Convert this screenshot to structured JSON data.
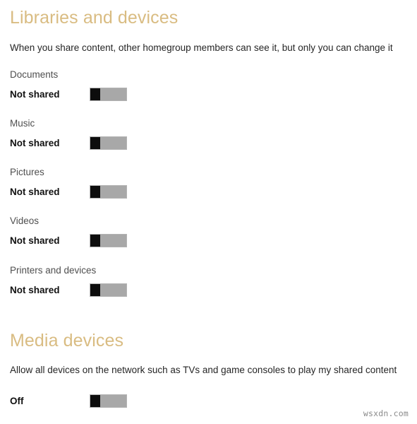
{
  "sections": [
    {
      "id": "libraries",
      "title": "Libraries and devices",
      "description": "When you share content, other homegroup members can see it, but only you can change it",
      "title_color": "#d9bc82",
      "rows": [
        {
          "label": "Documents",
          "state": "Not shared",
          "toggle": "off"
        },
        {
          "label": "Music",
          "state": "Not shared",
          "toggle": "off"
        },
        {
          "label": "Pictures",
          "state": "Not shared",
          "toggle": "off"
        },
        {
          "label": "Videos",
          "state": "Not shared",
          "toggle": "off"
        },
        {
          "label": "Printers and devices",
          "state": "Not shared",
          "toggle": "off"
        }
      ]
    },
    {
      "id": "media",
      "title": "Media devices",
      "description": "Allow all devices on the network such as TVs and game consoles to play my shared content",
      "title_color": "#d9bc82",
      "rows": [
        {
          "label": "",
          "state": "Off",
          "toggle": "off"
        }
      ]
    }
  ],
  "watermark": "wsxdn.com"
}
